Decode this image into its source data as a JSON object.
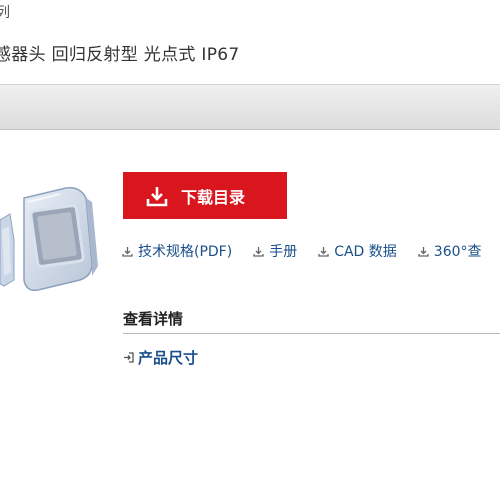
{
  "header": {
    "fragment": "列",
    "subtitle": "感器头 回归反射型 光点式 IP67"
  },
  "download": {
    "label": "下载目录"
  },
  "links": [
    {
      "label": "技术规格(PDF)"
    },
    {
      "label": "手册"
    },
    {
      "label": "CAD 数据"
    },
    {
      "label": "360°查"
    }
  ],
  "details": {
    "title": "查看详情",
    "item": "产品尺寸"
  },
  "colors": {
    "accent": "#d9151d",
    "link": "#1a4f8a"
  },
  "icons": [
    "download-icon",
    "arrow-into-box-icon"
  ]
}
